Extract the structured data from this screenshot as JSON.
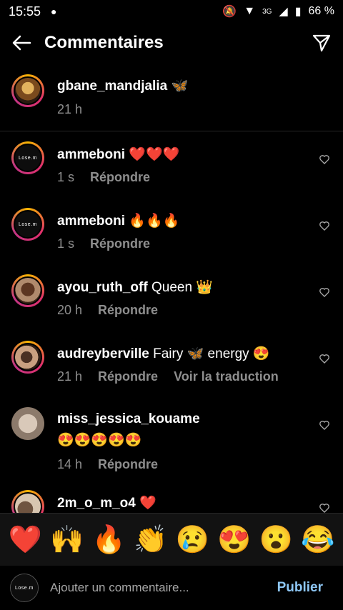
{
  "status": {
    "time": "15:55",
    "battery": "66 %",
    "network": "3G"
  },
  "header": {
    "title": "Commentaires"
  },
  "caption": {
    "username": "gbane_mandjalia",
    "text": "🦋",
    "time": "21 h"
  },
  "comments": [
    {
      "username": "ammeboni",
      "text": "❤️❤️❤️",
      "time": "1 s",
      "reply": "Répondre",
      "translate": ""
    },
    {
      "username": "ammeboni",
      "text": "🔥🔥🔥",
      "time": "1 s",
      "reply": "Répondre",
      "translate": ""
    },
    {
      "username": "ayou_ruth_off",
      "text": "Queen 👑",
      "time": "20 h",
      "reply": "Répondre",
      "translate": ""
    },
    {
      "username": "audreyberville",
      "text": "Fairy 🦋 energy 😍",
      "time": "21 h",
      "reply": "Répondre",
      "translate": "Voir la traduction"
    },
    {
      "username": "miss_jessica_kouame",
      "text": "😍😍😍😍😍",
      "time": "14 h",
      "reply": "Répondre",
      "translate": ""
    },
    {
      "username": "2m_o_m_o4",
      "text": "❤️",
      "time": "",
      "reply": "",
      "translate": ""
    }
  ],
  "emojis": [
    "❤️",
    "🙌",
    "🔥",
    "👏",
    "😢",
    "😍",
    "😮",
    "😂"
  ],
  "composer": {
    "placeholder": "Ajouter un commentaire...",
    "publish": "Publier",
    "avatar_text": "Lose.m"
  },
  "avatars": {
    "logo_text": "Lose.m"
  }
}
